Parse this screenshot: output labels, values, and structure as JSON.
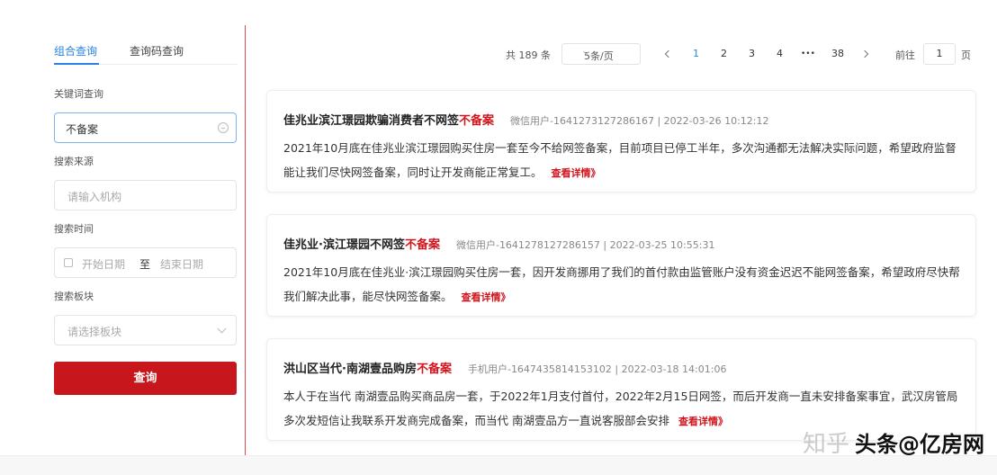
{
  "sidebar": {
    "tabs": [
      "组合查询",
      "查询码查询"
    ],
    "keyword_label": "关键词查询",
    "keyword_value": "不备案",
    "source_label": "搜索来源",
    "source_placeholder": "请输入机构",
    "time_label": "搜索时间",
    "date_start_placeholder": "开始日期",
    "date_separator": "至",
    "date_end_placeholder": "结束日期",
    "board_label": "搜索板块",
    "board_placeholder": "请选择板块",
    "query_button": "查询"
  },
  "pagination": {
    "total": "共 189 条",
    "page_size": "5条/页",
    "pages": [
      "1",
      "2",
      "3",
      "4",
      "•••",
      "38"
    ],
    "current": "1",
    "goto_label": "前往",
    "goto_value": "1",
    "goto_unit": "页"
  },
  "posts": [
    {
      "title": "佳兆业滨江璟园欺骗消费者不网签",
      "badge": "不备案",
      "meta": "微信用户-1641273127286167  |  2022-03-26 10:12:12",
      "body": "2021年10月底在佳兆业滨江璟园购买住房一套至今不给网签备案，目前项目已停工半年，多次沟通都无法解决实际问题，希望政府监督能让我们尽快网签备案，同时让开发商能正常复工。",
      "more": "查看详情》"
    },
    {
      "title": "佳兆业·滨江璟园不网签",
      "badge": "不备案",
      "meta": "微信用户-1641278127286157  |  2022-03-25 10:55:31",
      "body": "2021年10月底在佳兆业·滨江璟园购买住房一套，因开发商挪用了我们的首付款由监管账户没有资金迟迟不能网签备案，希望政府尽快帮我们解决此事，能尽快网签备案。",
      "more": "查看详情》"
    },
    {
      "title": "洪山区当代·南湖壹品购房",
      "badge": "不备案",
      "meta": "手机用户-1647435814153102  |  2022-03-18 14:01:06",
      "body": "本人于在当代 南湖壹品购买商品房一套，于2022年1月支付首付，2022年2月15日网签，而后开发商一直未安排备案事宜，武汉房管局多次发短信让我联系开发商完成备案，而当代 南湖壹品方一直说客服部会安排",
      "more": "查看详情》"
    }
  ],
  "watermark": {
    "zhihu": "知乎",
    "prefix": "头条",
    "handle": "@亿房网",
    "faded": "@亿房网"
  },
  "colors": {
    "accent_red": "#c8161d",
    "link_blue": "#2a82e4",
    "badge_red": "#d4141c"
  }
}
